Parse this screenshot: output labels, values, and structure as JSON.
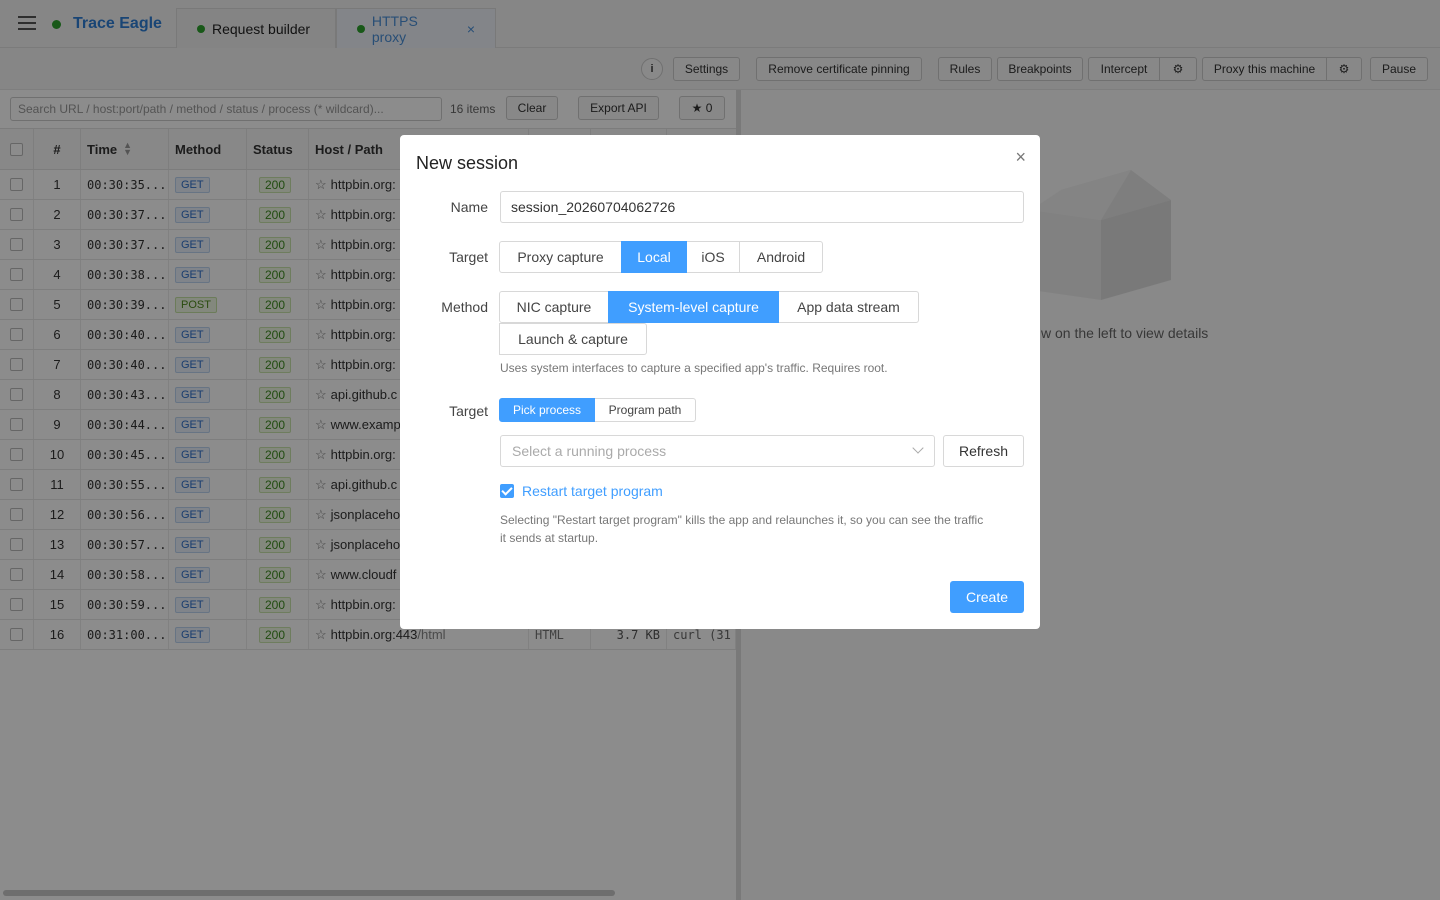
{
  "app": {
    "title": "Trace Eagle",
    "status_color": "#2ca02c",
    "accent": "#409eff"
  },
  "tabs": [
    {
      "label": "Request builder"
    },
    {
      "label": "HTTPS proxy",
      "close": "×"
    }
  ],
  "toolbar": {
    "info_glyph": "i",
    "settings": "Settings",
    "remove_pinning": "Remove certificate pinning",
    "rules": "Rules",
    "breakpoints": "Breakpoints",
    "intercept": "Intercept",
    "proxy_machine": "Proxy this machine",
    "pause": "Pause"
  },
  "list": {
    "search_placeholder": "Search URL / host:port/path / method / status / process (* wildcard)...",
    "count": "16 items",
    "clear": "Clear",
    "export": "Export API",
    "starred": "★ 0",
    "columns": {
      "num": "#",
      "time": "Time",
      "method": "Method",
      "status": "Status",
      "host": "Host / Path"
    },
    "rows": [
      {
        "n": "1",
        "time": "00:30:35....",
        "method": "GET",
        "status": "200",
        "host": "httpbin.org:"
      },
      {
        "n": "2",
        "time": "00:30:37....",
        "method": "GET",
        "status": "200",
        "host": "httpbin.org:"
      },
      {
        "n": "3",
        "time": "00:30:37....",
        "method": "GET",
        "status": "200",
        "host": "httpbin.org:"
      },
      {
        "n": "4",
        "time": "00:30:38....",
        "method": "GET",
        "status": "200",
        "host": "httpbin.org:"
      },
      {
        "n": "5",
        "time": "00:30:39....",
        "method": "POST",
        "status": "200",
        "host": "httpbin.org:"
      },
      {
        "n": "6",
        "time": "00:30:40....",
        "method": "GET",
        "status": "200",
        "host": "httpbin.org:"
      },
      {
        "n": "7",
        "time": "00:30:40....",
        "method": "GET",
        "status": "200",
        "host": "httpbin.org:"
      },
      {
        "n": "8",
        "time": "00:30:43....",
        "method": "GET",
        "status": "200",
        "host": "api.github.c"
      },
      {
        "n": "9",
        "time": "00:30:44....",
        "method": "GET",
        "status": "200",
        "host": "www.examp"
      },
      {
        "n": "10",
        "time": "00:30:45....",
        "method": "GET",
        "status": "200",
        "host": "httpbin.org:"
      },
      {
        "n": "11",
        "time": "00:30:55....",
        "method": "GET",
        "status": "200",
        "host": "api.github.c"
      },
      {
        "n": "12",
        "time": "00:30:56....",
        "method": "GET",
        "status": "200",
        "host": "jsonplaceho"
      },
      {
        "n": "13",
        "time": "00:30:57....",
        "method": "GET",
        "status": "200",
        "host": "jsonplaceho"
      },
      {
        "n": "14",
        "time": "00:30:58....",
        "method": "GET",
        "status": "200",
        "host": "www.cloudf"
      },
      {
        "n": "15",
        "time": "00:30:59....",
        "method": "GET",
        "status": "200",
        "host": "httpbin.org:"
      },
      {
        "n": "16",
        "time": "00:31:00....",
        "method": "GET",
        "status": "200",
        "host": "httpbin.org:443",
        "path": "/html",
        "type": "HTML",
        "size": "3.7 KB",
        "process": "curl (31"
      }
    ]
  },
  "detail": {
    "hint": "w on the left to view details"
  },
  "modal": {
    "title": "New session",
    "close": "×",
    "name_label": "Name",
    "name_value": "session_20260704062726",
    "target_label": "Target",
    "target_options": [
      "Proxy capture",
      "Local",
      "iOS",
      "Android"
    ],
    "target_selected": "Local",
    "method_label": "Method",
    "method_options": [
      "NIC capture",
      "System-level capture",
      "App data stream",
      "Launch & capture"
    ],
    "method_selected": "System-level capture",
    "method_hint": "Uses system interfaces to capture a specified app's traffic. Requires root.",
    "target2_label": "Target",
    "target2_options": [
      "Pick process",
      "Program path"
    ],
    "target2_selected": "Pick process",
    "process_placeholder": "Select a running process",
    "refresh": "Refresh",
    "restart_label": "Restart target program",
    "restart_checked": true,
    "restart_hint_1": "Selecting \"Restart target program\" kills the app and relaunches it, so you can see the traffic",
    "restart_hint_2": "it sends at startup.",
    "create": "Create"
  }
}
